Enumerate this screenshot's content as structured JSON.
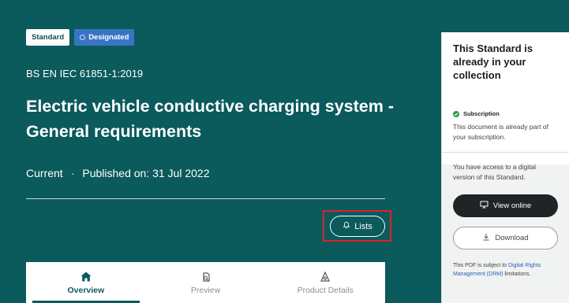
{
  "hero": {
    "badges": {
      "standard": "Standard",
      "designated": "Designated"
    },
    "code": "BS EN IEC 61851-1:2019",
    "title": "Electric vehicle conductive charging system - General requirements",
    "status": "Current",
    "separator": "·",
    "published": "Published on: 31 Jul 2022",
    "lists_button": "Lists"
  },
  "tabs": [
    {
      "label": "Overview",
      "icon": "home-icon",
      "active": true
    },
    {
      "label": "Preview",
      "icon": "preview-icon",
      "active": false
    },
    {
      "label": "Product Details",
      "icon": "details-icon",
      "active": false
    }
  ],
  "sidebar": {
    "heading": "This Standard is already in your collection",
    "subscription_label": "Subscription",
    "subscription_note": "This document is already part of your subscription.",
    "access_note": "You have access to a digital version of this Standard.",
    "view_button": "View online",
    "download_button": "Download",
    "drm_prefix": "This PDF is subject to ",
    "drm_link": "Digital Rights Management (DRM)",
    "drm_suffix": " limitations."
  },
  "colors": {
    "hero_bg": "#0b5a5c",
    "designated_badge": "#3a75c4",
    "highlight_box": "#e0202a",
    "view_button_bg": "#1f2427",
    "link": "#2d62b8",
    "subscription_check": "#2e9a47"
  }
}
